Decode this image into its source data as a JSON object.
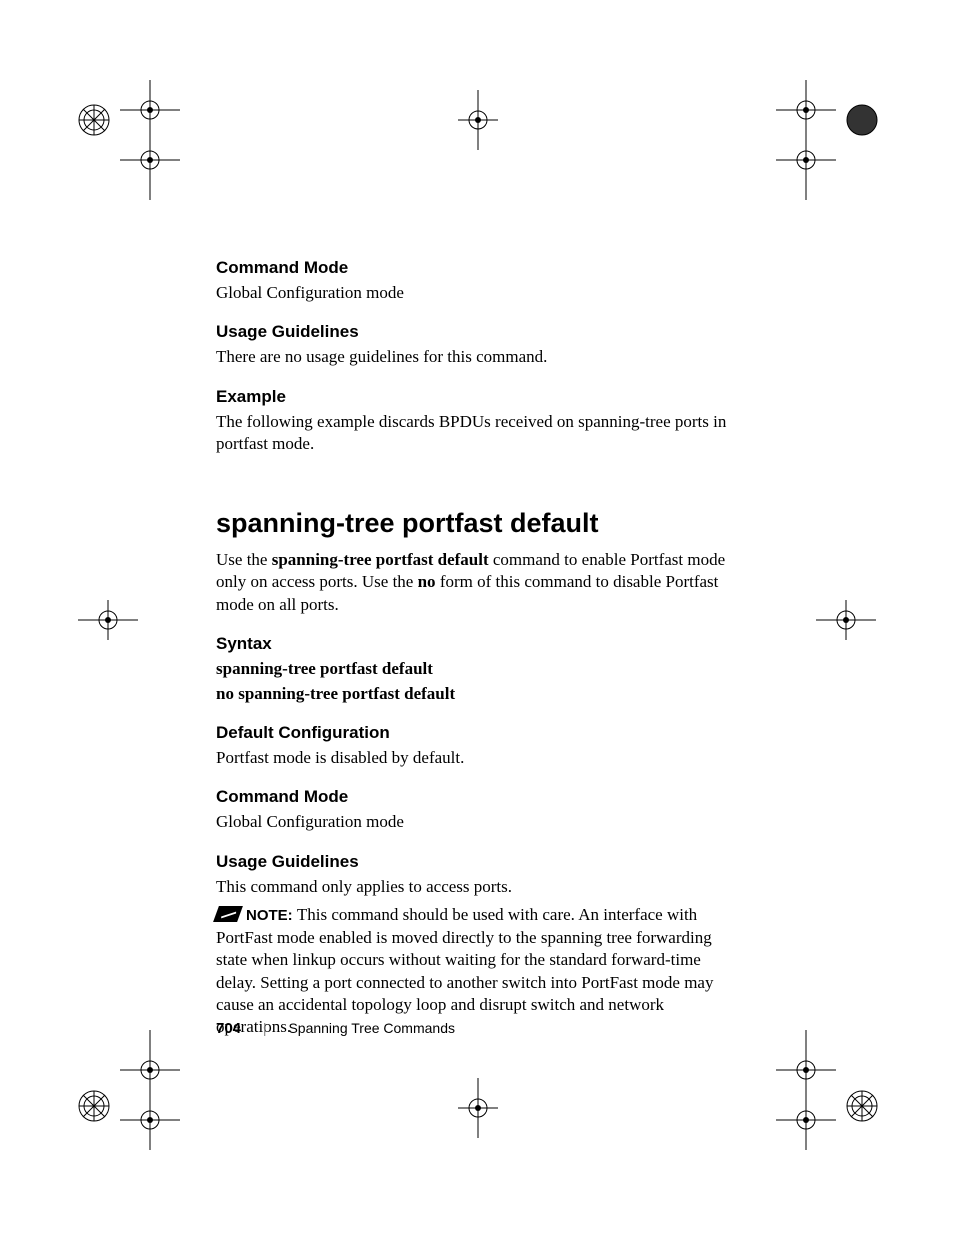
{
  "sections": {
    "cmdmode1_h": "Command Mode",
    "cmdmode1_t": "Global Configuration mode",
    "usage1_h": "Usage Guidelines",
    "usage1_t": "There are no usage guidelines for this command.",
    "example_h": "Example",
    "example_t": "The following example discards BPDUs received on spanning-tree ports in portfast mode.",
    "main_h": "spanning-tree portfast default",
    "main_t_1": "Use the ",
    "main_t_bold1": "spanning-tree portfast default",
    "main_t_2": " command to enable Portfast mode only on access ports. Use the ",
    "main_t_bold2": "no",
    "main_t_3": " form of this command to disable Portfast mode on all ports.",
    "syntax_h": "Syntax",
    "syntax_l1": "spanning-tree portfast default",
    "syntax_l2": "no spanning-tree portfast default",
    "defcfg_h": "Default Configuration",
    "defcfg_t": "Portfast mode is disabled by default.",
    "cmdmode2_h": "Command Mode",
    "cmdmode2_t": "Global Configuration mode",
    "usage2_h": "Usage Guidelines",
    "usage2_t": "This command only applies to access ports.",
    "note_label": "NOTE: ",
    "note_t": "This command should be used with care. An interface with PortFast mode enabled is moved directly to the spanning tree forwarding state when linkup occurs without waiting for the standard forward-time delay. Setting a port connected to another switch into PortFast mode may cause an accidental topology loop and disrupt switch and network operations."
  },
  "footer": {
    "page": "704",
    "chapter": "Spanning Tree Commands"
  }
}
